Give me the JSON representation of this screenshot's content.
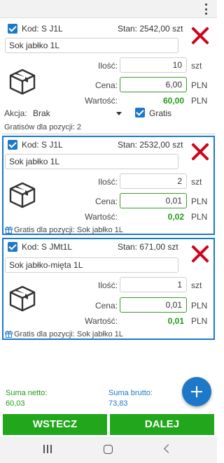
{
  "app": {
    "menu_icon": "more-vert-icon"
  },
  "items": [
    {
      "checked": true,
      "kod": "Kod: S J1L",
      "stan": "Stan: 2542,00 szt",
      "name": "Sok jabłko 1L",
      "ilosc_label": "Ilość:",
      "ilosc": "10",
      "ilosc_unit": "szt",
      "cena_label": "Cena:",
      "cena": "6,00",
      "cena_unit": "PLN",
      "wartosc_label": "Wartość:",
      "wartosc": "60,00",
      "wartosc_unit": "PLN",
      "akcja_label": "Akcja:",
      "akcja_value": "Brak",
      "gratis_checked": true,
      "gratis_label": "Gratis",
      "note": "Gratisów dla pozycji: 2"
    },
    {
      "checked": true,
      "kod": "Kod: S J1L",
      "stan": "Stan: 2532,00 szt",
      "name": "Sok jabłko 1L",
      "ilosc_label": "Ilość:",
      "ilosc": "2",
      "ilosc_unit": "szt",
      "cena_label": "Cena:",
      "cena": "0,01",
      "cena_unit": "PLN",
      "wartosc_label": "Wartość:",
      "wartosc": "0,02",
      "wartosc_unit": "PLN",
      "note": "Gratis dla pozycji: Sok jabłko 1L"
    },
    {
      "checked": true,
      "kod": "Kod: S JMt1L",
      "stan": "Stan: 671,00 szt",
      "name": "Sok jabłko-mięta 1L",
      "ilosc_label": "Ilość:",
      "ilosc": "1",
      "ilosc_unit": "szt",
      "cena_label": "Cena:",
      "cena": "0,01",
      "cena_unit": "PLN",
      "wartosc_label": "Wartość:",
      "wartosc": "0,01",
      "wartosc_unit": "PLN",
      "note": "Gratis dla pozycji: Sok jabłko 1L"
    }
  ],
  "summary": {
    "netto_label": "Suma netto:",
    "netto_value": "60,03",
    "brutto_label": "Suma brutto:",
    "brutto_value": "73,83"
  },
  "buttons": {
    "back": "WSTECZ",
    "next": "DALEJ"
  },
  "colors": {
    "accent": "#1e78c8",
    "green": "#22a61c",
    "delete": "#d0021b"
  }
}
